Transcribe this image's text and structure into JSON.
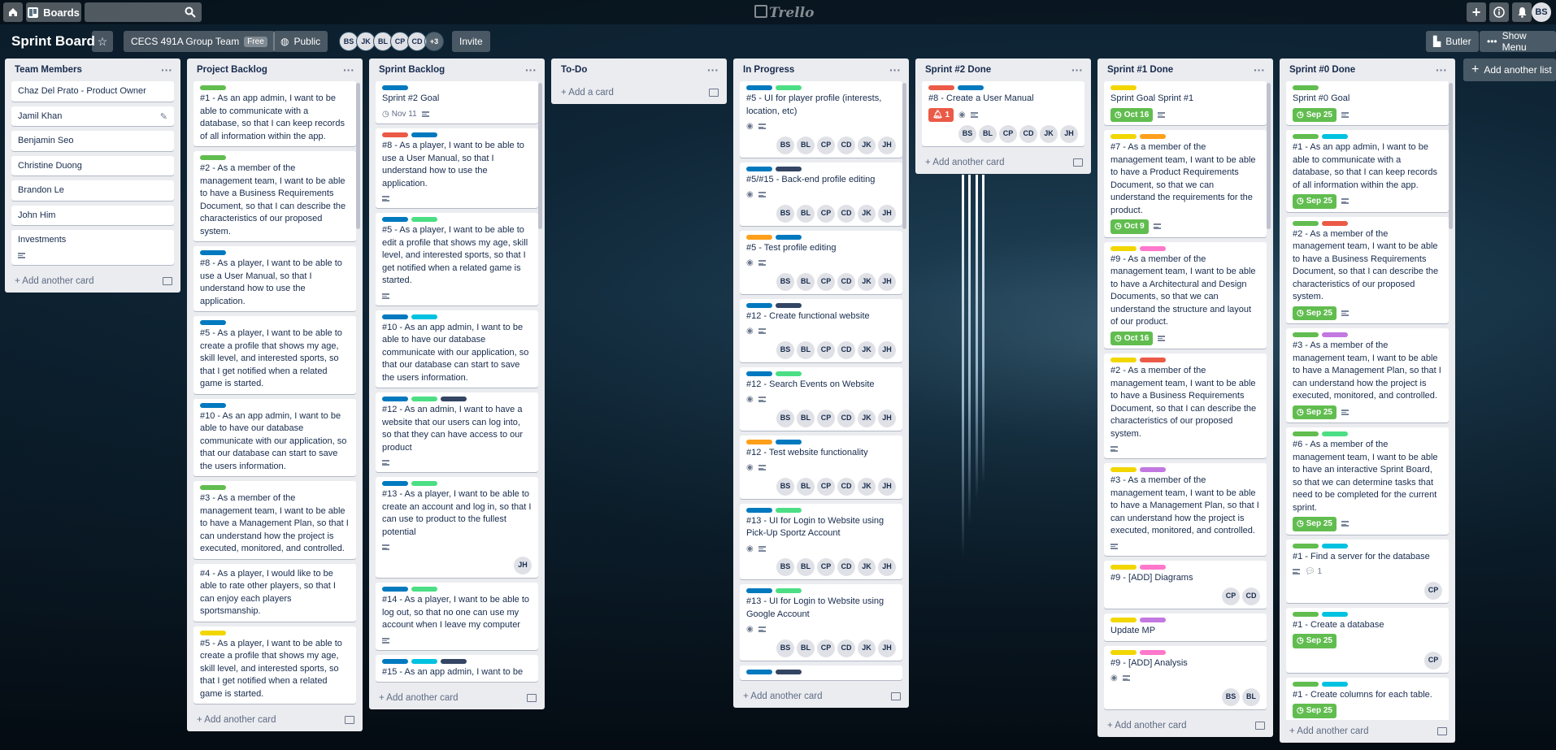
{
  "header": {
    "boards_label": "Boards",
    "search_placeholder": "",
    "logo": "Trello",
    "user_initials": "BS"
  },
  "board": {
    "title": "Sprint Board",
    "team": "CECS 491A Group Team",
    "team_badge": "Free",
    "visibility": "Public",
    "members": [
      "BS",
      "JK",
      "BL",
      "CP",
      "CD"
    ],
    "members_more": "+3",
    "invite": "Invite",
    "butler": "Butler",
    "show_menu": "Show Menu",
    "add_list": "Add another list"
  },
  "colors": {
    "green": "#61bd4f",
    "blue": "#0079bf",
    "red": "#eb5a46",
    "teal": "#4bde84",
    "cyan": "#00c2e0",
    "navy": "#344563",
    "orange": "#ff9f1a",
    "yellow": "#f2d600",
    "purple": "#c377e0",
    "pink": "#ff78cb",
    "sky": "#00c2e0"
  },
  "lists": [
    {
      "title": "Team Members",
      "add_label": "Add another card",
      "cards": [
        {
          "text": "Chaz Del Prato - Product Owner"
        },
        {
          "text": "Jamil Khan",
          "editing": true
        },
        {
          "text": "Benjamin Seo"
        },
        {
          "text": "Christine Duong"
        },
        {
          "text": "Brandon Le"
        },
        {
          "text": "John Him"
        },
        {
          "text": "Investments",
          "desc": true
        }
      ]
    },
    {
      "title": "Project Backlog",
      "add_label": "Add another card",
      "cards": [
        {
          "labels": [
            "green"
          ],
          "text": "#1 - As an app admin, I want to be able to communicate with a database, so that I can keep records of all information within the app."
        },
        {
          "labels": [
            "green"
          ],
          "text": "#2 - As a member of the management team, I want to be able to have a Business Requirements Document, so that I can describe the characteristics of our proposed system."
        },
        {
          "labels": [
            "blue"
          ],
          "text": "#8 - As a player, I want to be able to use a User Manual, so that I understand how to use the application."
        },
        {
          "labels": [
            "blue"
          ],
          "text": "#5 - As a player, I want to be able to create a profile that shows my age, skill level, and interested sports, so that I get notified when a related game is started."
        },
        {
          "labels": [
            "blue"
          ],
          "text": "#10 - As an app admin, I want to be able to have our database communicate with our application, so that our database can start to save the users information."
        },
        {
          "labels": [
            "green"
          ],
          "text": "#3 - As a member of the management team, I want to be able to have a Management Plan, so that I can understand how the project is executed, monitored, and controlled."
        },
        {
          "labels": [],
          "text": "#4 - As a player, I would like to be able to rate other players, so that I can enjoy each players sportsmanship."
        },
        {
          "labels": [
            "yellow"
          ],
          "text": "#5 - As a player, I want to be able to create a profile that shows my age, skill level, and interested sports, so that I get notified when a related game is started."
        }
      ]
    },
    {
      "title": "Sprint Backlog",
      "add_label": "Add another card",
      "cards": [
        {
          "labels": [
            "blue"
          ],
          "text": "Sprint #2 Goal",
          "due": "Nov 11",
          "due_plain": true,
          "desc": true
        },
        {
          "labels": [
            "red",
            "blue"
          ],
          "text": "#8 - As a player, I want to be able to use a User Manual, so that I understand how to use the application.",
          "desc": true
        },
        {
          "labels": [
            "blue",
            "teal"
          ],
          "text": "#5 - As a player, I want to be able to edit a profile that shows my age, skill level, and interested sports, so that I get notified when a related game is started.",
          "desc": true
        },
        {
          "labels": [
            "blue",
            "cyan"
          ],
          "text": "#10 - As an app admin, I want to be able to have our database communicate with our application, so that our database can start to save the users information."
        },
        {
          "labels": [
            "blue",
            "teal",
            "navy"
          ],
          "text": "#12 - As an admin, I want to have a website that our users can log into, so that they can have access to our product",
          "desc": true
        },
        {
          "labels": [
            "blue",
            "teal"
          ],
          "text": "#13 - As a player, I want to be able to create an account and log in, so that I can use to product to the fullest potential",
          "desc": true,
          "members": [
            "JH"
          ]
        },
        {
          "labels": [
            "blue",
            "teal"
          ],
          "text": "#14 - As a player, I want to be able to log out, so that no one can use my account when I leave my computer",
          "desc": true
        },
        {
          "labels": [
            "blue",
            "cyan",
            "navy"
          ],
          "text": "#15 - As an app admin, I want to be"
        }
      ]
    },
    {
      "title": "To-Do",
      "add_label": "Add a card",
      "cards": []
    },
    {
      "title": "In Progress",
      "add_label": "Add another card",
      "cards": [
        {
          "labels": [
            "blue",
            "teal"
          ],
          "text": "#5 - UI for player profile (interests, location, etc)",
          "watch": true,
          "desc": true,
          "members": [
            "BS",
            "BL",
            "CP",
            "CD",
            "JK",
            "JH"
          ]
        },
        {
          "labels": [
            "blue",
            "navy"
          ],
          "text": "#5/#15 - Back-end profile editing",
          "watch": true,
          "desc": true,
          "members": [
            "BS",
            "BL",
            "CP",
            "CD",
            "JK",
            "JH"
          ]
        },
        {
          "labels": [
            "orange",
            "blue"
          ],
          "text": "#5 - Test profile editing",
          "watch": true,
          "desc": true,
          "members": [
            "BS",
            "BL",
            "CP",
            "CD",
            "JK",
            "JH"
          ]
        },
        {
          "labels": [
            "blue",
            "navy"
          ],
          "text": "#12 - Create functional website",
          "watch": true,
          "desc": true,
          "members": [
            "BS",
            "BL",
            "CP",
            "CD",
            "JK",
            "JH"
          ]
        },
        {
          "labels": [
            "blue",
            "teal"
          ],
          "text": "#12 - Search Events on Website",
          "watch": true,
          "desc": true,
          "members": [
            "BS",
            "BL",
            "CP",
            "CD",
            "JK",
            "JH"
          ]
        },
        {
          "labels": [
            "orange",
            "blue"
          ],
          "text": "#12 - Test website functionality",
          "watch": true,
          "desc": true,
          "members": [
            "BS",
            "BL",
            "CP",
            "CD",
            "JK",
            "JH"
          ]
        },
        {
          "labels": [
            "blue",
            "teal"
          ],
          "text": "#13 - UI for Login to Website using Pick-Up Sportz Account",
          "watch": true,
          "desc": true,
          "members": [
            "BS",
            "BL",
            "CP",
            "CD",
            "JK",
            "JH"
          ]
        },
        {
          "labels": [
            "blue",
            "teal"
          ],
          "text": "#13 - UI for Login to Website using Google Account",
          "watch": true,
          "desc": true,
          "members": [
            "BS",
            "BL",
            "CP",
            "CD",
            "JK",
            "JH"
          ]
        },
        {
          "labels": [
            "blue",
            "navy"
          ],
          "text": ""
        }
      ]
    },
    {
      "title": "Sprint #2 Done",
      "add_label": "Add another card",
      "cards": [
        {
          "labels": [
            "red",
            "blue"
          ],
          "text": "#8 - Create a User Manual",
          "notif": "1",
          "watch": true,
          "desc": true,
          "members": [
            "BS",
            "BL",
            "CP",
            "CD",
            "JK",
            "JH"
          ]
        }
      ]
    },
    {
      "title": "Sprint #1 Done",
      "add_label": "Add another card",
      "cards": [
        {
          "labels": [
            "yellow"
          ],
          "text": "Sprint Goal Sprint #1",
          "due": "Oct 16",
          "desc": true
        },
        {
          "labels": [
            "yellow",
            "orange"
          ],
          "text": "#7 - As a member of the management team, I want to be able to have a Product Requirements Document, so that we can understand the requirements for the product.",
          "due": "Oct 9",
          "desc": true
        },
        {
          "labels": [
            "yellow",
            "pink"
          ],
          "text": "#9 - As a member of the management team, I want to be able to have a Architectural and Design Documents, so that we can understand the structure and layout of our product.",
          "due": "Oct 16",
          "desc": true
        },
        {
          "labels": [
            "yellow",
            "red"
          ],
          "text": "#2 - As a member of the management team, I want to be able to have a Business Requirements Document, so that I can describe the characteristics of our proposed system.",
          "desc": true
        },
        {
          "labels": [
            "yellow",
            "purple"
          ],
          "text": "#3 - As a member of the management team, I want to be able to have a Management Plan, so that I can understand how the project is executed, monitored, and controlled.",
          "desc": true
        },
        {
          "labels": [
            "yellow",
            "pink"
          ],
          "text": "#9 - [ADD] Diagrams",
          "members": [
            "CP",
            "CD"
          ]
        },
        {
          "labels": [
            "yellow",
            "purple"
          ],
          "text": "Update MP"
        },
        {
          "labels": [
            "yellow",
            "pink"
          ],
          "text": "#9 - [ADD] Analysis",
          "watch": true,
          "desc": true,
          "members": [
            "BS",
            "BL"
          ]
        }
      ]
    },
    {
      "title": "Sprint #0 Done",
      "add_label": "Add another card",
      "cards": [
        {
          "labels": [
            "green"
          ],
          "text": "Sprint #0 Goal",
          "due": "Sep 25",
          "desc": true
        },
        {
          "labels": [
            "green",
            "cyan"
          ],
          "text": "#1 - As an app admin, I want to be able to communicate with a database, so that I can keep records of all information within the app.",
          "due": "Sep 25",
          "desc": true
        },
        {
          "labels": [
            "green",
            "red"
          ],
          "text": "#2 - As a member of the management team, I want to be able to have a Business Requirements Document, so that I can describe the characteristics of our proposed system.",
          "due": "Sep 25",
          "desc": true
        },
        {
          "labels": [
            "green",
            "purple"
          ],
          "text": "#3 - As a member of the management team, I want to be able to have a Management Plan, so that I can understand how the project is executed, monitored, and controlled.",
          "due": "Sep 25",
          "desc": true
        },
        {
          "labels": [
            "green",
            "teal"
          ],
          "text": "#6 - As a member of the management team, I want to be able to have an interactive Sprint Board, so that we can determine tasks that need to be completed for the current sprint.",
          "due": "Sep 25",
          "desc": true
        },
        {
          "labels": [
            "green",
            "cyan"
          ],
          "text": "#1 - Find a server for the database",
          "desc": true,
          "comments": "1",
          "members": [
            "CP"
          ]
        },
        {
          "labels": [
            "green",
            "cyan"
          ],
          "text": "#1 - Create a database",
          "due": "Sep 25",
          "members": [
            "CP"
          ]
        },
        {
          "labels": [
            "green",
            "cyan"
          ],
          "text": "#1 - Create columns for each table.",
          "due": "Sep 25",
          "members": [
            "CP"
          ]
        }
      ]
    }
  ]
}
